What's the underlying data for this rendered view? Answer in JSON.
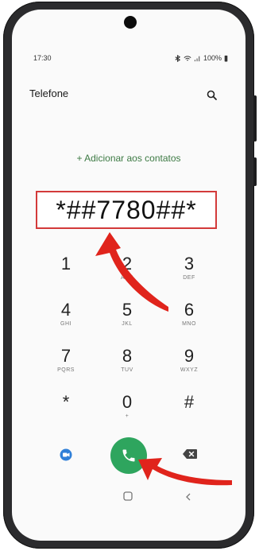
{
  "status_bar": {
    "time": "17:30",
    "battery": "100%"
  },
  "app": {
    "title": "Telefone"
  },
  "add_contact": {
    "label": "+ Adicionar aos contatos"
  },
  "dialed_number": "*##7780##*",
  "keypad": [
    {
      "digit": "1",
      "letters": ""
    },
    {
      "digit": "2",
      "letters": "ABC"
    },
    {
      "digit": "3",
      "letters": "DEF"
    },
    {
      "digit": "4",
      "letters": "GHI"
    },
    {
      "digit": "5",
      "letters": "JKL"
    },
    {
      "digit": "6",
      "letters": "MNO"
    },
    {
      "digit": "7",
      "letters": "PQRS"
    },
    {
      "digit": "8",
      "letters": "TUV"
    },
    {
      "digit": "9",
      "letters": "WXYZ"
    },
    {
      "digit": "*",
      "letters": ""
    },
    {
      "digit": "0",
      "letters": "+"
    },
    {
      "digit": "#",
      "letters": ""
    }
  ],
  "icons": {
    "search": "search-icon",
    "video_call": "video-call-icon",
    "call": "phone-icon",
    "backspace": "backspace-icon",
    "home": "home-icon",
    "back": "back-icon"
  },
  "colors": {
    "accent": "#2ea55e",
    "highlight": "#d33a3a",
    "add_link": "#3d7a44"
  }
}
